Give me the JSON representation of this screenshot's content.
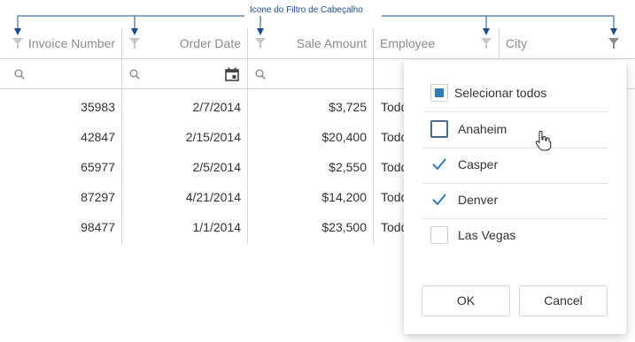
{
  "annotation": {
    "label": "Icone do Filtro de Cabeçalho"
  },
  "columns": [
    {
      "key": "invoice",
      "label": "Invoice Number"
    },
    {
      "key": "order_date",
      "label": "Order Date"
    },
    {
      "key": "sale_amount",
      "label": "Sale Amount"
    },
    {
      "key": "employee",
      "label": "Employee"
    },
    {
      "key": "city",
      "label": "City"
    }
  ],
  "rows": [
    {
      "invoice": "35983",
      "order_date": "2/7/2014",
      "sale_amount": "$3,725",
      "employee": "Todd"
    },
    {
      "invoice": "42847",
      "order_date": "2/15/2014",
      "sale_amount": "$20,400",
      "employee": "Todd"
    },
    {
      "invoice": "65977",
      "order_date": "2/5/2014",
      "sale_amount": "$2,550",
      "employee": "Todd"
    },
    {
      "invoice": "87297",
      "order_date": "4/21/2014",
      "sale_amount": "$14,200",
      "employee": "Todd"
    },
    {
      "invoice": "98477",
      "order_date": "1/1/2014",
      "sale_amount": "$23,500",
      "employee": "Todd"
    }
  ],
  "filter_popup": {
    "select_all_label": "Selecionar todos",
    "items": [
      {
        "label": "Anaheim",
        "checked": false
      },
      {
        "label": "Casper",
        "checked": true
      },
      {
        "label": "Denver",
        "checked": true
      },
      {
        "label": "Las Vegas",
        "checked": false
      }
    ],
    "ok_label": "OK",
    "cancel_label": "Cancel"
  },
  "colors": {
    "accent": "#337ab7",
    "annotation": "#1e4d8c",
    "grid_line": "#d6d6d6",
    "header_text": "#8c8c8c"
  }
}
